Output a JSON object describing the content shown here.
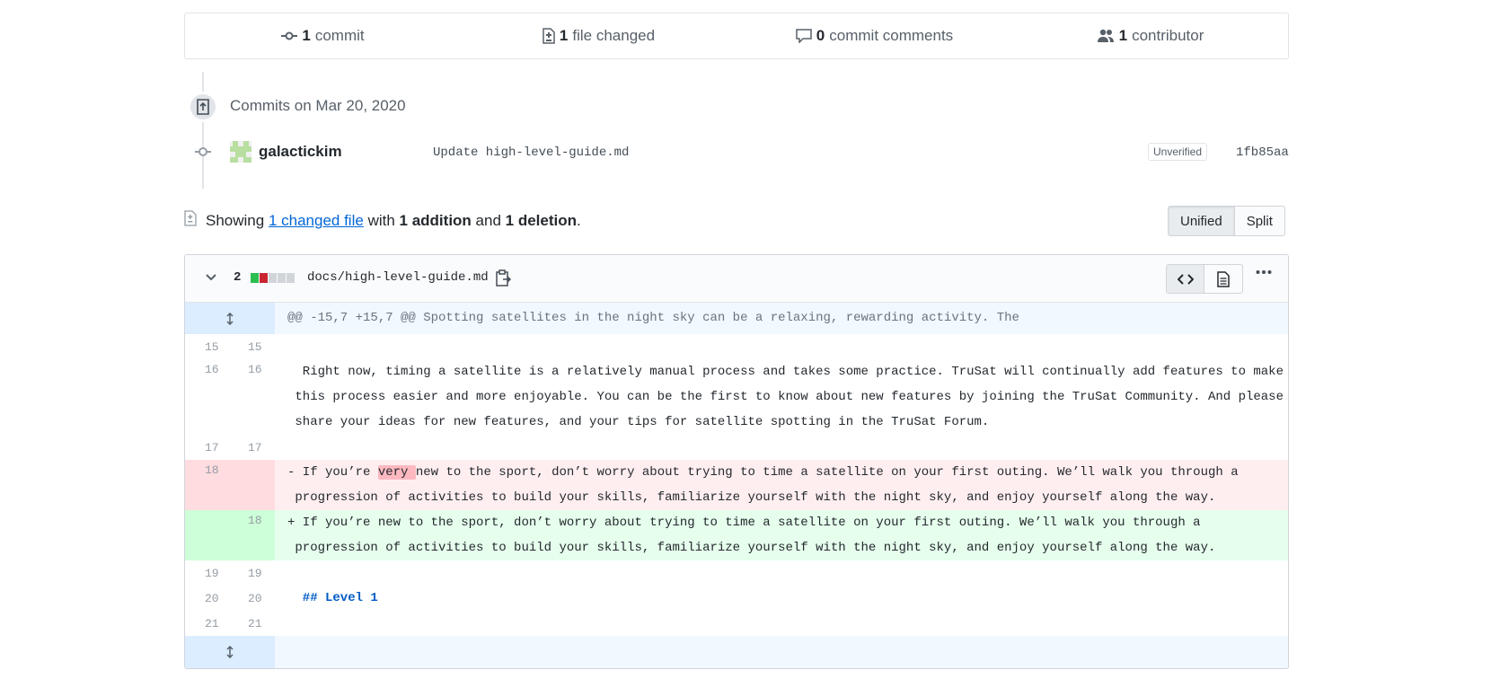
{
  "summary": {
    "commits_count": "1",
    "commits_label": "commit",
    "files_count": "1",
    "files_label": "file changed",
    "comments_count": "0",
    "comments_label": "commit comments",
    "contributors_count": "1",
    "contributors_label": "contributor"
  },
  "commits_group": {
    "date_label": "Commits on Mar 20, 2020"
  },
  "commit": {
    "author": "galactickim",
    "message": "Update high-level-guide.md",
    "badge": "Unverified",
    "sha": "1fb85aa"
  },
  "diff_summary": {
    "showing": "Showing",
    "changed_files_link": "1 changed file",
    "with": "with",
    "additions": "1 addition",
    "and": "and",
    "deletions": "1 deletion",
    "period": "."
  },
  "view_toggle": {
    "unified": "Unified",
    "split": "Split",
    "selected": "Unified"
  },
  "file": {
    "change_count": "2",
    "path": "docs/high-level-guide.md",
    "diffstat_colors": [
      "#2cbe4e",
      "#cb2431",
      "#d1d5da",
      "#d1d5da",
      "#d1d5da"
    ],
    "hunk_header": "@@ -15,7 +15,7 @@ Spotting satellites in the night sky can be a relaxing, rewarding activity. The",
    "lines": {
      "l15": {
        "old": "15",
        "new": "15",
        "text": ""
      },
      "l16": {
        "old": "16",
        "new": "16",
        "text1": "  Right now, timing a satellite is a relatively manual process and takes some practice. TruSat will continually add features to make",
        "text2": " this process easier and more enjoyable. You can be the first to know about new features by joining the TruSat Community. And please",
        "text3": " share your ideas for new features, and your tips for satellite spotting in the TruSat Forum."
      },
      "l17": {
        "old": "17",
        "new": "17",
        "text": ""
      },
      "del18": {
        "old": "18",
        "prefix": "- If you’re ",
        "highlight": "very ",
        "rest": "new to the sport, don’t worry about trying to time a satellite on your first outing. We’ll walk you through a",
        "text2": " progression of activities to build your skills, familiarize yourself with the night sky, and enjoy yourself along the way."
      },
      "add18": {
        "new": "18",
        "text1": "+ If you’re new to the sport, don’t worry about trying to time a satellite on your first outing. We’ll walk you through a",
        "text2": " progression of activities to build your skills, familiarize yourself with the night sky, and enjoy yourself along the way."
      },
      "l19": {
        "old": "19",
        "new": "19",
        "text": ""
      },
      "l20": {
        "old": "20",
        "new": "20",
        "text": "  ## Level 1"
      },
      "l21": {
        "old": "21",
        "new": "21",
        "text": ""
      }
    }
  }
}
